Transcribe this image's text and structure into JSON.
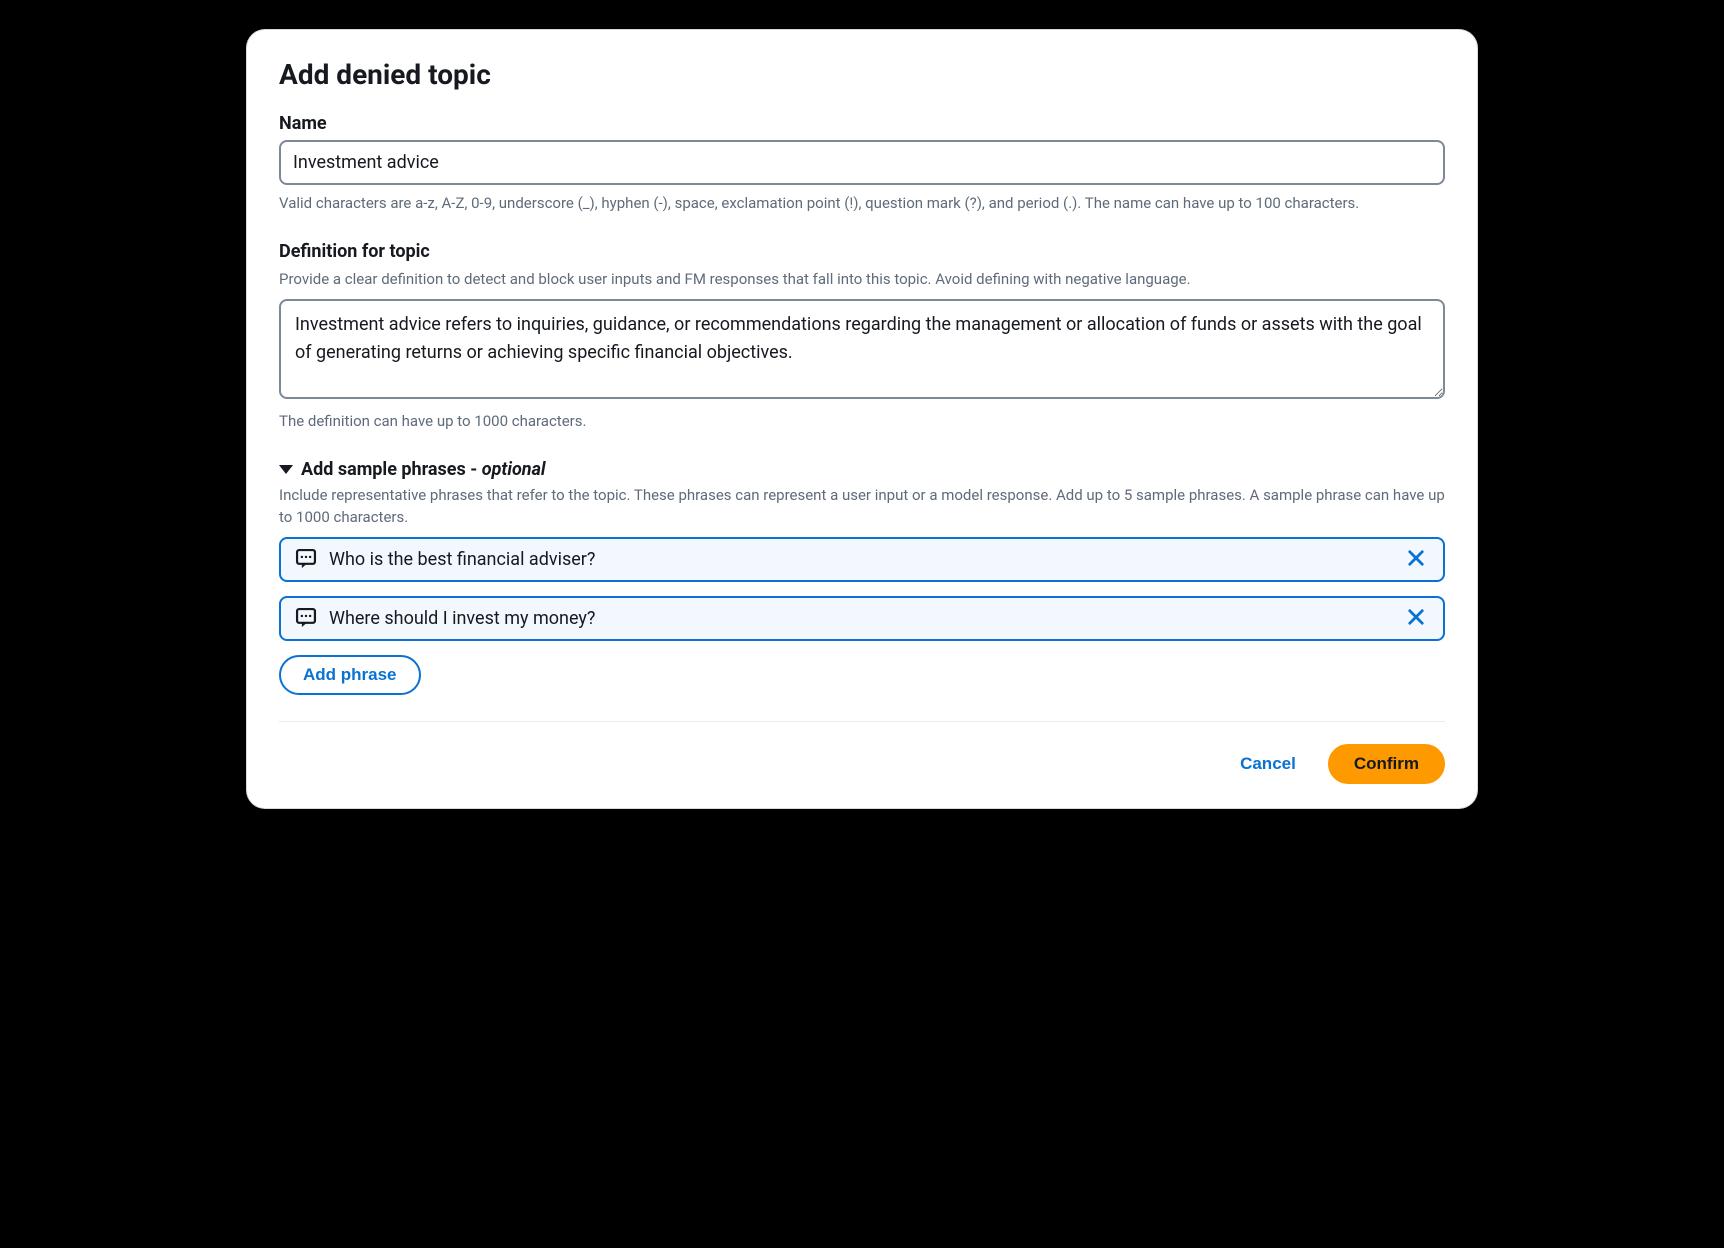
{
  "modal": {
    "title": "Add denied topic"
  },
  "name_field": {
    "label": "Name",
    "value": "Investment advice",
    "help": "Valid characters are a-z, A-Z, 0-9, underscore (_), hyphen (-), space, exclamation point (!), question mark (?), and period (.). The name can have up to 100 characters."
  },
  "definition_field": {
    "label": "Definition for topic",
    "sublabel": "Provide a clear definition to detect and block user inputs and FM responses that fall into this topic. Avoid defining with negative language.",
    "value": "Investment advice refers to inquiries, guidance, or recommendations regarding the management or allocation of funds or assets with the goal of generating returns or achieving specific financial objectives.",
    "help": "The definition can have up to 1000 characters."
  },
  "sample_phrases": {
    "header_main": "Add sample phrases -",
    "header_optional": " optional",
    "sublabel": "Include representative phrases that refer to the topic. These phrases can represent a user input or a model response. Add up to 5 sample phrases. A sample phrase can have up to 1000 characters.",
    "items": [
      {
        "text": "Who is the best financial adviser?"
      },
      {
        "text": "Where should I invest my money?"
      }
    ],
    "add_button": "Add phrase"
  },
  "footer": {
    "cancel": "Cancel",
    "confirm": "Confirm"
  }
}
